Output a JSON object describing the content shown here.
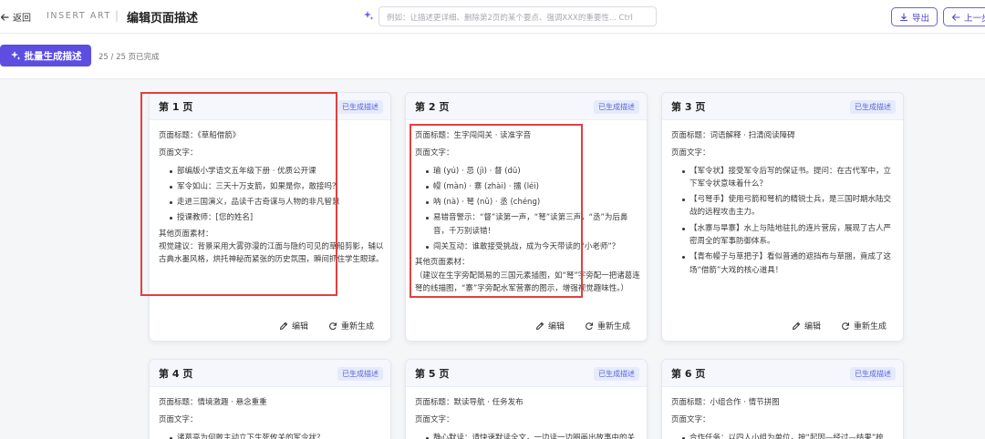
{
  "topbar": {
    "back_label": "返回",
    "brand": "INSERT ART",
    "separator": "|",
    "page_title": "编辑页面描述",
    "search_placeholder": "例如：让描述更详细、删除第2页的某个要点、强调XXX的重要性... Ctrl",
    "export_label": "导出",
    "prev_label": "上一步"
  },
  "toolbar": {
    "batch_label": "批量生成描述",
    "progress_text": "25 / 25 页已完成"
  },
  "card_actions": {
    "edit": "编辑",
    "regenerate": "重新生成"
  },
  "cards": [
    {
      "title": "第 1 页",
      "badge": "已生成描述",
      "page_title_line": "页面标题：《草船借箭》",
      "text_label": "页面文字：",
      "bullets": [
        "部编版小学语文五年级下册 · 优质公开课",
        "军令如山：三天十万支箭，如果是你，敢接吗？",
        "走进三国演义，品读千古奇谋与人物的非凡智慧",
        "授课教师：[您的姓名]"
      ],
      "other_label": "其他页面素材：",
      "other_text": "视觉建议：背景采用大雾弥漫的江面与隐约可见的草船剪影，辅以古典水墨风格，烘托神秘而紧张的历史氛围，瞬间抓住学生眼球。"
    },
    {
      "title": "第 2 页",
      "badge": "已生成描述",
      "page_title_line": "页面标题：生字闯闯关 · 读准字音",
      "text_label": "页面文字：",
      "bullets": [
        "瑜 (yú) · 忌 (jì) · 督 (dū)",
        "幔 (màn) · 寨 (zhài) · 擂 (léi)",
        "呐 (nà) · 弩 (nǔ) · 丞 (chéng)",
        "易错音警示：“督”读第一声，“弩”读第三声，“丞”为后鼻音，千万别读错！",
        "闯关互动：谁敢接受挑战，成为今天带读的“小老师”？"
      ],
      "other_label": "其他页面素材：",
      "other_text": "（建议在生字旁配简易的三国元素插图，如“弩”字旁配一把诸葛连弩的线描图，“寨”字旁配水军营寨的图示，增强视觉趣味性。）"
    },
    {
      "title": "第 3 页",
      "badge": "已生成描述",
      "page_title_line": "页面标题：词语解释 · 扫清阅读障碍",
      "text_label": "页面文字：",
      "bullets": [
        "【军令状】接受军令后写的保证书。提问：在古代军中，立下军令状意味着什么？",
        "【弓弩手】使用弓箭和弩机的精锐士兵，是三国时期水陆交战的远程攻击主力。",
        "【水寨与旱寨】水上与陆地驻扎的连片营房，展现了古人严密周全的军事防御体系。",
        "【青布幔子与草把子】看似普通的遮挡布与草捆，竟成了这场“借箭”大戏的核心道具！"
      ],
      "other_label": "",
      "other_text": ""
    },
    {
      "title": "第 4 页",
      "badge": "已生成描述",
      "page_title_line": "页面标题：情境激趣 · 悬念重重",
      "text_label": "页面文字：",
      "bullets": [
        "诸葛亮为何敢主动立下生死攸关的军令状？"
      ],
      "other_label": "",
      "other_text": ""
    },
    {
      "title": "第 5 页",
      "badge": "已生成描述",
      "page_title_line": "页面标题：默读导航 · 任务发布",
      "text_label": "页面文字：",
      "bullets": [
        "静心默读：请快速默读全文，一边读一边圈画出故事中的关键"
      ],
      "other_label": "",
      "other_text": ""
    },
    {
      "title": "第 6 页",
      "badge": "已生成描述",
      "page_title_line": "页面标题：小组合作 · 情节拼图",
      "text_label": "页面文字：",
      "bullets": [
        "合作任务：以四人小组为单位，按“起因—经过—结果”梳"
      ],
      "other_label": "",
      "other_text": ""
    }
  ]
}
